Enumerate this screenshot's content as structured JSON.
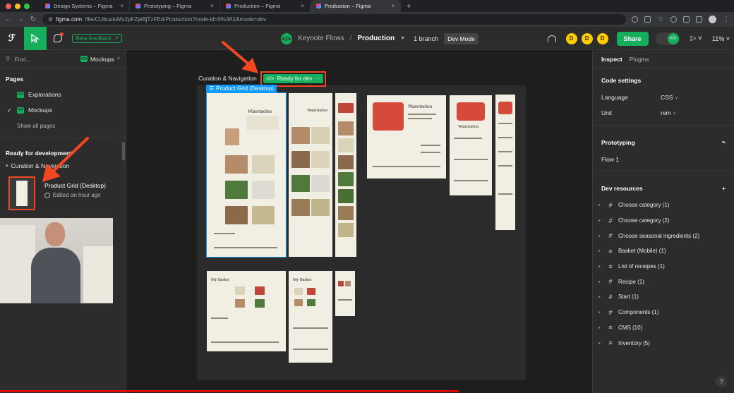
{
  "browser": {
    "tabs": [
      {
        "label": "Design Systems – Figma",
        "active": false
      },
      {
        "label": "Prototyping – Figma",
        "active": false
      },
      {
        "label": "Production – Figma",
        "active": false
      },
      {
        "label": "Production – Figma",
        "active": true
      }
    ],
    "url_host": "figma.com",
    "url_path": "/file/CUbuuioMx2pFZjeBjTzFEd/Production?node-id=0%3A1&mode=dev",
    "new_tab": "+",
    "close_tab": "×"
  },
  "toolbar": {
    "beta_feedback": "Beta feedback",
    "project": "Keynote Flows",
    "separator": "/",
    "page": "Production",
    "branch": "1 branch",
    "dev_mode": "Dev Mode",
    "avatars": [
      "D",
      "D",
      "D"
    ],
    "share": "Share",
    "zoom": "11%"
  },
  "left": {
    "find_placeholder": "Find...",
    "current_page": "Mockups",
    "pages_title": "Pages",
    "pages": [
      {
        "label": "Explorations",
        "current": false
      },
      {
        "label": "Mockups",
        "current": true
      }
    ],
    "show_all": "Show all pages",
    "ready_title": "Ready for development",
    "group": "Curation & Navigation",
    "frame_title": "Product Grid (Desktop)",
    "frame_edited": "Edited an hour ago"
  },
  "canvas": {
    "section_label": "Curation & Navigation",
    "ready_badge": "Ready for dev",
    "frame_label": "Product Grid (Desktop)"
  },
  "right": {
    "tabs": [
      "Inspect",
      "Plugins"
    ],
    "code_settings": "Code settings",
    "language_label": "Language",
    "language_value": "CSS",
    "unit_label": "Unit",
    "unit_value": "rem",
    "prototyping": "Prototyping",
    "flow": "Flow 1",
    "dev_resources": "Dev resources",
    "resources": [
      {
        "icon": "#",
        "label": "Choose category (1)"
      },
      {
        "icon": "#",
        "label": "Choose category (2)"
      },
      {
        "icon": "#",
        "label": "Choose seasonal ingredients (2)"
      },
      {
        "icon": "≡",
        "label": "Basket (Mobile) (1)"
      },
      {
        "icon": "≡",
        "label": "List of receipes (1)"
      },
      {
        "icon": "#",
        "label": "Recipe (1)"
      },
      {
        "icon": "#",
        "label": "Start (1)"
      },
      {
        "icon": "#",
        "label": "Components (1)"
      },
      {
        "icon": "≡",
        "label": "CMS (10)"
      },
      {
        "icon": "≡",
        "label": "Inventory (5)"
      }
    ],
    "help": "?"
  },
  "colors": {
    "figma_green": "#14ae5c",
    "selection_blue": "#0d99ff",
    "annotation_red": "#f24822",
    "avatar_yellow": "#ffcc00"
  }
}
